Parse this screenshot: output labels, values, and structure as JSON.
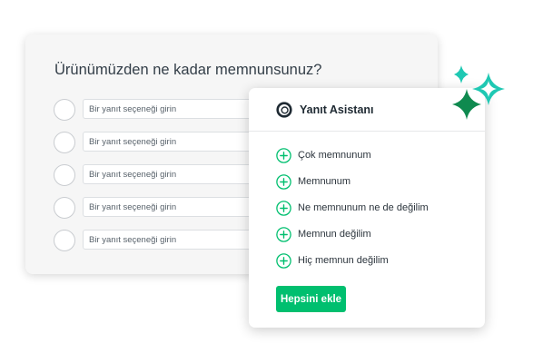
{
  "survey": {
    "question": "Ürünümüzden ne kadar memnunsunuz?",
    "options": [
      {
        "placeholder": "Bir yanıt seçeneği girin"
      },
      {
        "placeholder": "Bir yanıt seçeneği girin"
      },
      {
        "placeholder": "Bir yanıt seçeneği girin"
      },
      {
        "placeholder": "Bir yanıt seçeneği girin"
      },
      {
        "placeholder": "Bir yanıt seçeneği girin"
      }
    ]
  },
  "assistant": {
    "title": "Yanıt Asistanı",
    "logo_icon": "ring-logo-icon",
    "suggestions": [
      {
        "label": "Çok memnunum",
        "icon": "plus-circle-icon"
      },
      {
        "label": "Memnunum",
        "icon": "plus-circle-icon"
      },
      {
        "label": "Ne memnunum ne de değilim",
        "icon": "plus-circle-icon"
      },
      {
        "label": "Memnun değilim",
        "icon": "plus-circle-icon"
      },
      {
        "label": "Hiç memnun değilim",
        "icon": "plus-circle-icon"
      }
    ],
    "add_all_label": "Hepsini ekle"
  },
  "colors": {
    "accent": "#00bf6f",
    "sparkle_teal": "#1fc8b3",
    "sparkle_green": "#0f8a4f",
    "title_text": "#333e48"
  }
}
